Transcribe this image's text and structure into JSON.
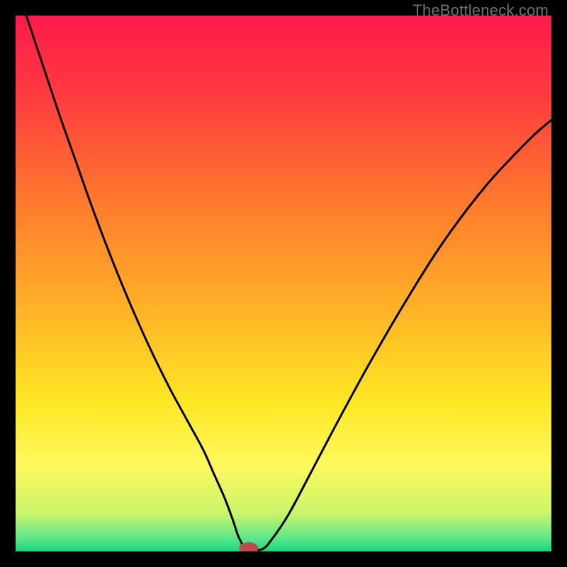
{
  "watermark": "TheBottleneck.com",
  "chart_data": {
    "type": "line",
    "title": "",
    "xlabel": "",
    "ylabel": "",
    "xlim": [
      0,
      100
    ],
    "ylim": [
      0,
      100
    ],
    "grid": false,
    "legend": false,
    "background_gradient_stops": [
      {
        "offset": 0.0,
        "color": "#ff1a4b"
      },
      {
        "offset": 0.15,
        "color": "#ff3b3f"
      },
      {
        "offset": 0.35,
        "color": "#ff7a2d"
      },
      {
        "offset": 0.55,
        "color": "#ffb327"
      },
      {
        "offset": 0.72,
        "color": "#ffe724"
      },
      {
        "offset": 0.84,
        "color": "#fff85e"
      },
      {
        "offset": 0.93,
        "color": "#c8f56a"
      },
      {
        "offset": 0.975,
        "color": "#5ee68a"
      },
      {
        "offset": 1.0,
        "color": "#17d87a"
      }
    ],
    "series": [
      {
        "name": "curve",
        "color": "#000000",
        "x": [
          2,
          5,
          8,
          11,
          14,
          17,
          20,
          23,
          26,
          29,
          32,
          35,
          37,
          39,
          40.5,
          41.5,
          42.5,
          43,
          46,
          48,
          51,
          55,
          60,
          66,
          73,
          80,
          88,
          96,
          100
        ],
        "y": [
          100,
          91,
          82,
          73.5,
          65,
          57,
          49.5,
          42.5,
          36,
          30,
          24.5,
          19,
          14.5,
          10,
          6,
          3,
          1,
          0.4,
          0.4,
          2.5,
          7,
          14.5,
          24,
          35,
          47,
          58,
          68.5,
          77,
          80.5
        ]
      }
    ],
    "marker": {
      "x": 43.5,
      "y": 0.6,
      "color": "#c24a4a",
      "rx": 1.8,
      "ry": 1.1
    }
  }
}
